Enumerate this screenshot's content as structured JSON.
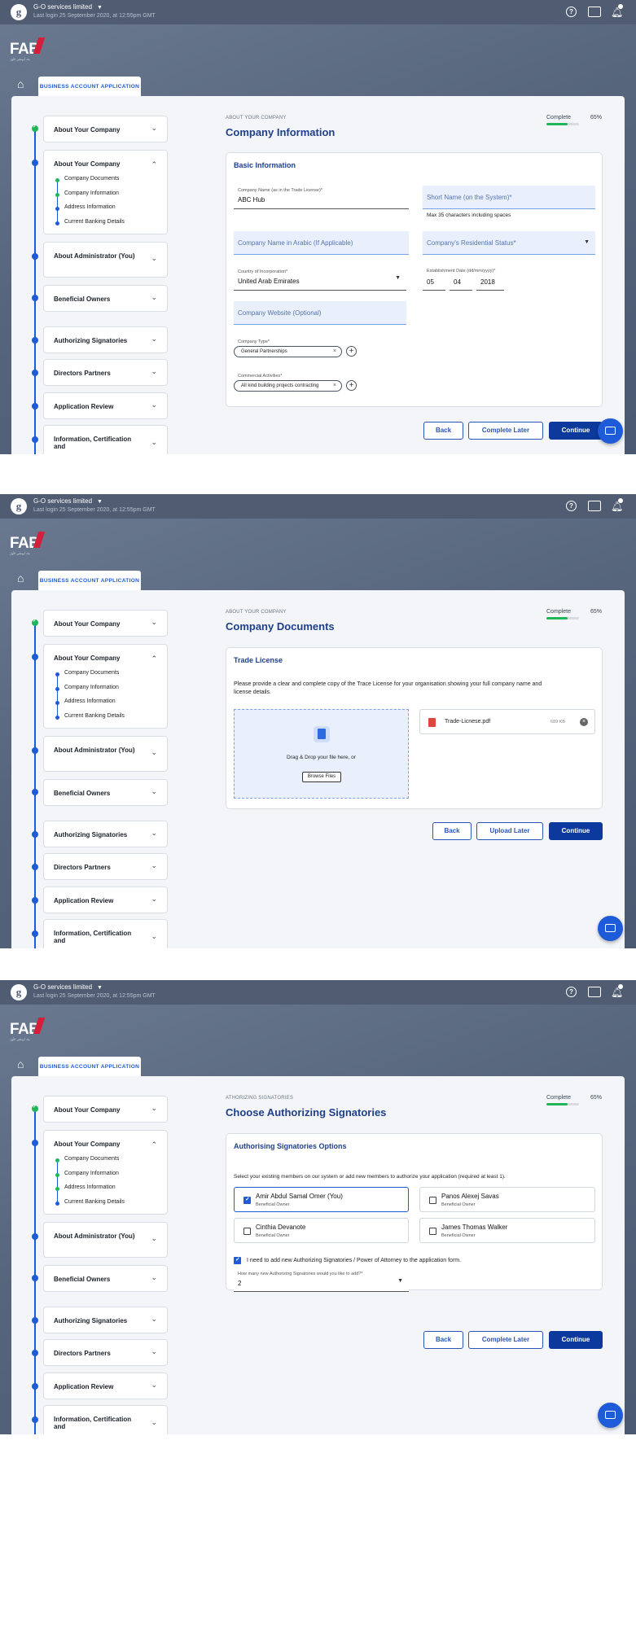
{
  "colors": {
    "accent": "#1e5bd8",
    "primary_button": "#0c3a9c",
    "success": "#21b55a",
    "brand_red": "#d31f3a",
    "background": "#56657c"
  },
  "header": {
    "account_name": "G-O services limited",
    "last_login": "Last login 25 September 2020, at 12:55pm GMT",
    "logo_text": "FAB",
    "logo_sub": "بنك أبوظبي الأول",
    "tab_label": "BUSINESS ACCOUNT APPLICATION",
    "icons": [
      "help-icon",
      "chat-icon",
      "bell-icon",
      "home-icon"
    ]
  },
  "sidebar": {
    "steps": [
      {
        "label": "About Your Company"
      },
      {
        "label": "About Your Company",
        "substeps": [
          "Company Documents",
          "Company Information",
          "Address Information",
          "Current Banking Details"
        ]
      },
      {
        "label": "About Administrator (You)"
      },
      {
        "label": "Beneficial Owners"
      },
      {
        "label": "Authorizing Signatories"
      },
      {
        "label": "Directors Partners"
      },
      {
        "label": "Application Review"
      },
      {
        "label": "Information, Certification and"
      }
    ]
  },
  "progress": {
    "label": "Complete",
    "percent": "65%",
    "value": 0.65
  },
  "screen1": {
    "breadcrumb": "ABOUT YOUR COMPANY",
    "title": "Company Information",
    "card_title": "Basic Information",
    "company_name_label": "Company Name (as in the Trade License)*",
    "company_name_value": "ABC Hub",
    "short_name_placeholder": "Short Name (on the System)*",
    "short_name_hint": "Max 35 characters including spaces",
    "arabic_name_placeholder": "Company Name in Arabic (If Applicable)",
    "residential_status_placeholder": "Company's Residential Status*",
    "country_label": "Country of Incorporation*",
    "country_value": "United Arab Emirates",
    "date_label": "Establishment Date (dd/mm/yyyy)*",
    "date_day": "05",
    "date_month": "04",
    "date_year": "2018",
    "website_placeholder": "Company Website (Optional)",
    "company_type_label": "Company Type*",
    "company_type_chip": "General Partnerships",
    "activities_label": "Commercial Activities*",
    "activities_chip": "All kind building projects contracting",
    "btn_back": "Back",
    "btn_later": "Complete Later",
    "btn_continue": "Continue"
  },
  "screen2": {
    "breadcrumb": "ABOUT YOUR COMPANY",
    "title": "Company Documents",
    "card_title": "Trade License",
    "description": "Please provide a clear and complete copy of the Trace License for your organisation showing your full company name and license details.",
    "drop_text": "Drag & Drop your file here, or",
    "browse_label": "Browse Files",
    "file_name": "Trade-Licnese.pdf",
    "file_size": "689 KB",
    "btn_back": "Back",
    "btn_upload_later": "Upload Later",
    "btn_continue": "Continue"
  },
  "screen3": {
    "breadcrumb": "ATHORIZING SIGNATORIES",
    "title": "Choose Authorizing Signatories",
    "card_title": "Authorising Signatories Options",
    "instruction": "Select your existing members on our system or add new members to authorize your application (required at least 1).",
    "members": [
      {
        "name": "Amir Abdul Samal Omer (You)",
        "role": "Beneficial Owner",
        "checked": true
      },
      {
        "name": "Panos Alexej Savas",
        "role": "Beneficial Owner",
        "checked": false
      },
      {
        "name": "Cinthia Devanote",
        "role": "Beneficial Owner",
        "checked": false
      },
      {
        "name": "James Thomas Walker",
        "role": "Beneficial Owner",
        "checked": false
      }
    ],
    "add_new_label": "I need to add new Authorizing Signatories / Power of Attorney to the application form.",
    "how_many_label": "How many new Authorizing Signatories would you like to add?*",
    "how_many_value": "2",
    "btn_back": "Back",
    "btn_later": "Complete Later",
    "btn_continue": "Continue"
  }
}
